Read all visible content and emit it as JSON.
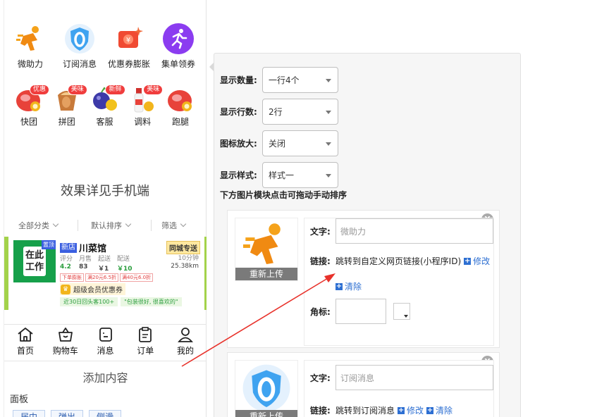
{
  "preview": {
    "row1": [
      {
        "label": "微助力",
        "icon": "running-man-icon"
      },
      {
        "label": "订阅消息",
        "icon": "subscribe-shield-icon"
      },
      {
        "label": "优惠券膨胀",
        "icon": "coupon-icon"
      },
      {
        "label": "集单领券",
        "icon": "purple-runner-icon"
      }
    ],
    "row2": [
      {
        "label": "快团",
        "badge": "优惠"
      },
      {
        "label": "拼团",
        "badge": "美味"
      },
      {
        "label": "客服",
        "badge": "新鲜"
      },
      {
        "label": "调料",
        "badge": "美味"
      },
      {
        "label": "跑腿",
        "badge": ""
      }
    ],
    "note": "效果详见手机端",
    "filters": {
      "category": "全部分类",
      "sort": "默认排序",
      "filter": "筛选"
    },
    "store": {
      "logo_line1": "在此",
      "logo_line2": "工作",
      "logo_tag": "置顶",
      "new_tag": "新店",
      "name": "川菜馆",
      "delivery": "同城专送",
      "stats": [
        {
          "label": "评分",
          "value": "4.2"
        },
        {
          "label": "月售",
          "value": "83"
        },
        {
          "label": "起送",
          "value": "￥1"
        },
        {
          "label": "配送",
          "value": "￥10"
        }
      ],
      "time": "10分钟",
      "distance": "25.38km",
      "promos": [
        "下单膨胀",
        "满20元6.5折",
        "满40元6.0折"
      ],
      "vip": "超级会员优惠券",
      "reviews": [
        "近30日回头客100+",
        "\"包装很好, 很喜欢的\""
      ]
    },
    "tabs": [
      {
        "label": "首页",
        "icon": "home-icon"
      },
      {
        "label": "购物车",
        "icon": "cart-icon"
      },
      {
        "label": "消息",
        "icon": "message-icon"
      },
      {
        "label": "订单",
        "icon": "order-icon"
      },
      {
        "label": "我的",
        "icon": "user-icon"
      }
    ],
    "add_title": "添加内容",
    "panel_label": "面板",
    "modes": [
      "居中",
      "弹出",
      "侧滑"
    ]
  },
  "settings": {
    "rows": [
      {
        "label": "显示数量:",
        "value": "一行4个"
      },
      {
        "label": "显示行数:",
        "value": "2行"
      },
      {
        "label": "图标放大:",
        "value": "关闭"
      },
      {
        "label": "显示样式:",
        "value": "样式一"
      }
    ],
    "sort_hint": "下方图片模块点击可拖动手动排序",
    "items": [
      {
        "reupload": "重新上传",
        "text_label": "文字:",
        "text_placeholder": "微助力",
        "link_label": "链接:",
        "link_text": "跳转到自定义网页链接(小程序ID)",
        "modify": "修改",
        "clear": "清除",
        "badge_label": "角标:",
        "close": "X"
      },
      {
        "reupload": "重新上传",
        "text_label": "文字:",
        "text_placeholder": "订阅消息",
        "link_label": "链接:",
        "link_text": "跳转到订阅消息",
        "modify": "修改",
        "clear": "清除",
        "close": "X"
      }
    ]
  },
  "colors": {
    "accent": "#2d6fd2",
    "arrow": "#e8322b",
    "store_border": "#a3d24a"
  }
}
